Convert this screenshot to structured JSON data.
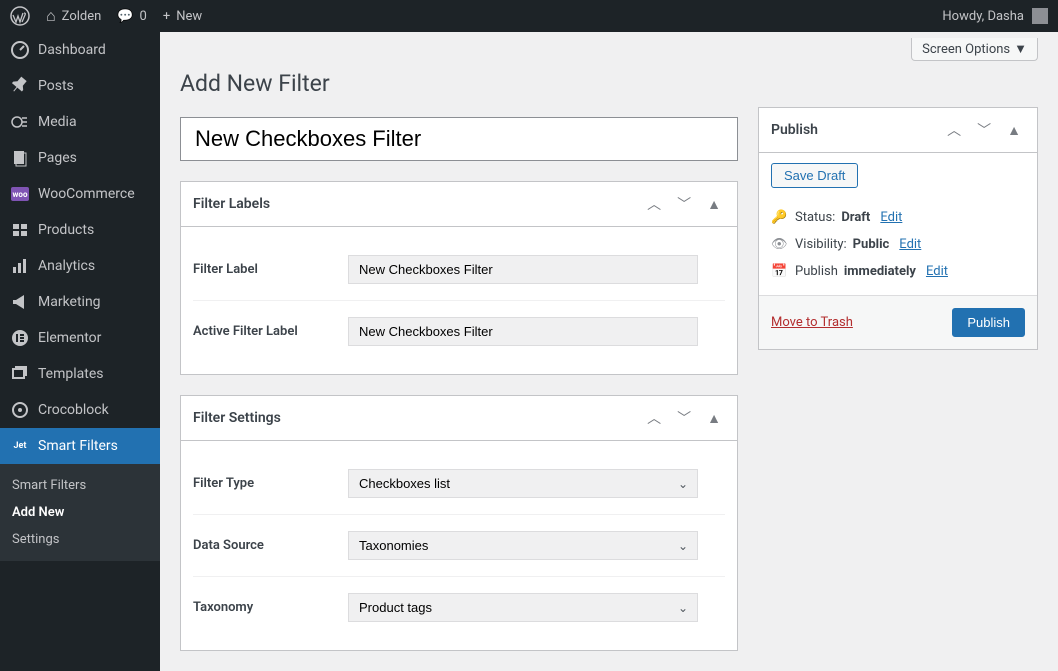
{
  "admin_bar": {
    "site_name": "Zolden",
    "comments_count": "0",
    "new_label": "New",
    "howdy": "Howdy, Dasha"
  },
  "sidebar": {
    "items": [
      {
        "label": "Dashboard"
      },
      {
        "label": "Posts"
      },
      {
        "label": "Media"
      },
      {
        "label": "Pages"
      },
      {
        "label": "WooCommerce"
      },
      {
        "label": "Products"
      },
      {
        "label": "Analytics"
      },
      {
        "label": "Marketing"
      },
      {
        "label": "Elementor"
      },
      {
        "label": "Templates"
      },
      {
        "label": "Crocoblock"
      },
      {
        "label": "Smart Filters"
      }
    ],
    "submenu": [
      {
        "label": "Smart Filters"
      },
      {
        "label": "Add New"
      },
      {
        "label": "Settings"
      }
    ]
  },
  "screen_options": "Screen Options",
  "page_title": "Add New Filter",
  "title_value": "New Checkboxes Filter",
  "boxes": {
    "labels": {
      "title": "Filter Labels",
      "fields": {
        "filter_label": {
          "label": "Filter Label",
          "value": "New Checkboxes Filter"
        },
        "active_filter_label": {
          "label": "Active Filter Label",
          "value": "New Checkboxes Filter"
        }
      }
    },
    "settings": {
      "title": "Filter Settings",
      "fields": {
        "filter_type": {
          "label": "Filter Type",
          "value": "Checkboxes list"
        },
        "data_source": {
          "label": "Data Source",
          "value": "Taxonomies"
        },
        "taxonomy": {
          "label": "Taxonomy",
          "value": "Product tags"
        }
      }
    }
  },
  "publish": {
    "title": "Publish",
    "save_draft": "Save Draft",
    "status_label": "Status:",
    "status_value": "Draft",
    "visibility_label": "Visibility:",
    "visibility_value": "Public",
    "publish_label": "Publish",
    "publish_value": "immediately",
    "edit": "Edit",
    "trash": "Move to Trash",
    "publish_btn": "Publish"
  }
}
